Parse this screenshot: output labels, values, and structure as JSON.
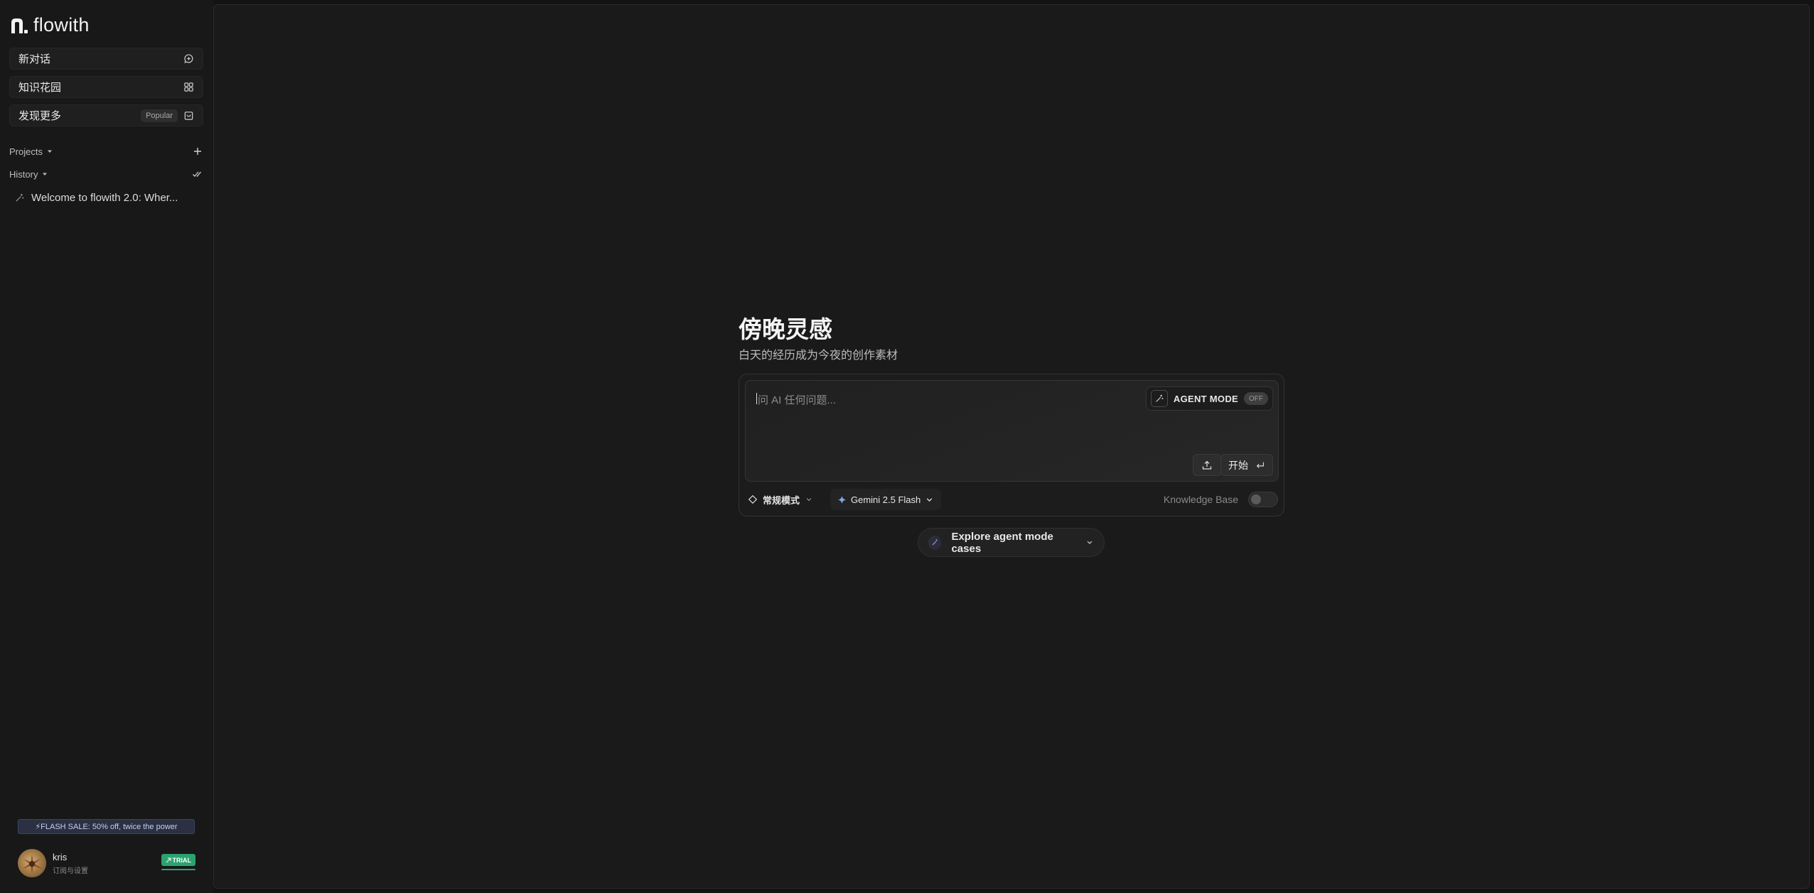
{
  "brand": {
    "name": "flowith"
  },
  "sidebar": {
    "nav": [
      {
        "label": "新对话",
        "icon": "chat-plus-icon"
      },
      {
        "label": "知识花园",
        "icon": "grid-icon"
      },
      {
        "label": "发现更多",
        "icon": "store-bag-icon",
        "badge": "Popular"
      }
    ],
    "projects": {
      "label": "Projects",
      "action_icon": "plus-icon"
    },
    "history": {
      "label": "History",
      "action_icon": "check-all-icon",
      "items": [
        {
          "title": "Welcome to flowith 2.0: Wher..."
        }
      ]
    },
    "flash_sale": "⚡FLASH SALE: 50% off, twice the power",
    "user": {
      "name": "kris",
      "subtitle": "订阅与设置",
      "badge": "TRIAL"
    }
  },
  "main": {
    "title": "傍晚灵感",
    "subtitle": "白天的经历成为今夜的创作素材",
    "composer": {
      "placeholder": "问 AI 任何问题...",
      "agent_mode_label": "AGENT MODE",
      "agent_mode_state": "OFF",
      "start_label": "开始",
      "mode_label": "常规模式",
      "model_label": "Gemini 2.5 Flash",
      "knowledge_base_label": "Knowledge Base",
      "knowledge_base_enabled": false
    },
    "explore_label": "Explore agent mode cases"
  },
  "colors": {
    "background": "#131313",
    "panel": "#1a1a1a",
    "accent_green": "#2aa46f",
    "flash_bg": "#2b3042"
  }
}
